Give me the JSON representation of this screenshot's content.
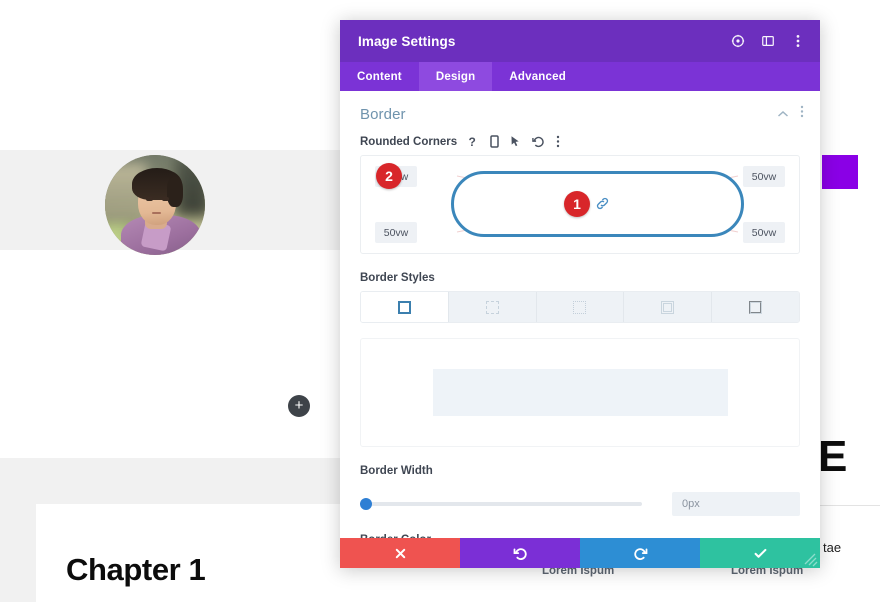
{
  "page": {
    "avatar_alt": "profile-photo",
    "add_button_label": "+",
    "chapter_heading": "Chapter 1",
    "big_letter": "E",
    "trailing_text": "tae",
    "footer_labels": [
      "Lorem Ispum",
      "Lorem Ispum"
    ]
  },
  "modal": {
    "title": "Image Settings",
    "header_icons": [
      "target-icon",
      "layout-icon",
      "more-vertical-icon"
    ],
    "tabs": [
      {
        "label": "Content",
        "active": false
      },
      {
        "label": "Design",
        "active": true
      },
      {
        "label": "Advanced",
        "active": false
      }
    ],
    "section": {
      "title": "Border",
      "tools": [
        "chevron-up-icon",
        "more-vertical-icon"
      ]
    },
    "rounded_corners": {
      "label": "Rounded Corners",
      "icons": [
        "help-icon",
        "mobile-icon",
        "cursor-icon",
        "reset-icon",
        "more-vertical-icon"
      ],
      "values": {
        "top_left": "50vw",
        "top_right": "50vw",
        "bottom_left": "50vw",
        "bottom_right": "50vw"
      },
      "link_icon": "link-icon",
      "annotations": [
        {
          "number": "1",
          "position": "center"
        },
        {
          "number": "2",
          "position": "top-left"
        }
      ]
    },
    "border_styles": {
      "label": "Border Styles",
      "options": [
        {
          "name": "solid",
          "selected": true
        },
        {
          "name": "dashed",
          "selected": false
        },
        {
          "name": "dotted",
          "selected": false
        },
        {
          "name": "double",
          "selected": false
        },
        {
          "name": "groove",
          "selected": false
        }
      ]
    },
    "border_width": {
      "label": "Border Width",
      "value": "0px",
      "slider_percent": 0
    },
    "border_color": {
      "label": "Border Color"
    },
    "footer_buttons": [
      {
        "name": "cancel",
        "icon": "close-icon",
        "color": "#ef5350"
      },
      {
        "name": "undo",
        "icon": "undo-icon",
        "color": "#7b2fd6"
      },
      {
        "name": "redo",
        "icon": "redo-icon",
        "color": "#2d8ed4"
      },
      {
        "name": "save",
        "icon": "check-icon",
        "color": "#2ec2a0"
      }
    ]
  },
  "colors": {
    "modal_header": "#6c2fbe",
    "tab_bar": "#7b33d6",
    "tab_active": "#8e4ae0",
    "accent_blue": "#3b87bb",
    "badge_red": "#d8262a",
    "purple_block": "#8a00e6"
  }
}
